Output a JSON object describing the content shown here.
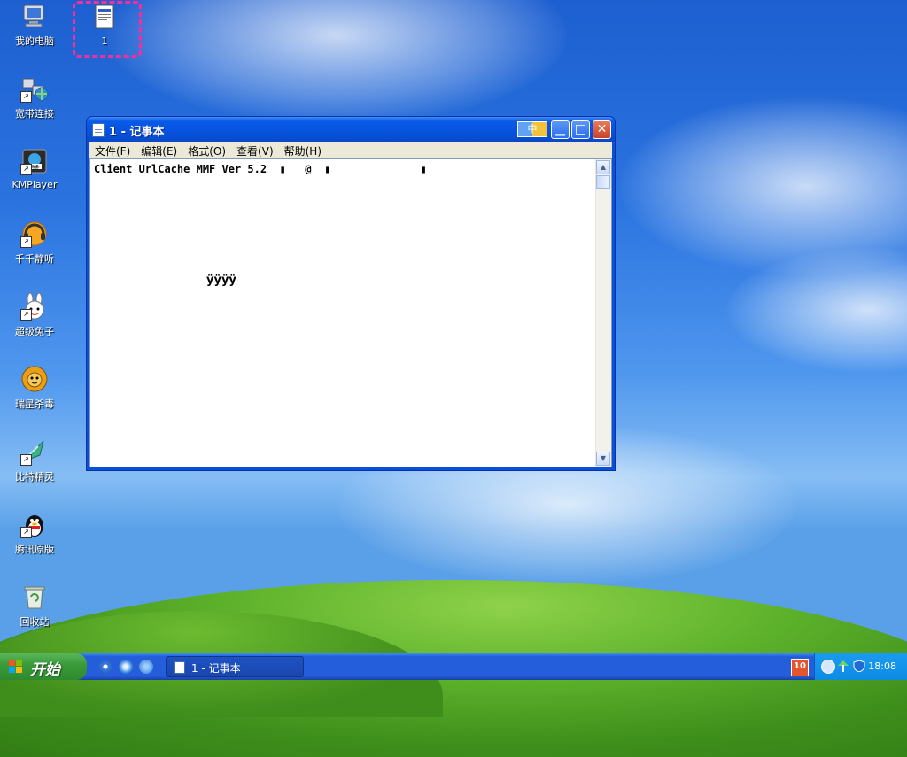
{
  "desktop": {
    "icons": [
      {
        "label": "我的电脑",
        "icon": "my-computer-icon"
      },
      {
        "label": "宽带连接",
        "icon": "network-connection-icon"
      },
      {
        "label": "KMPlayer",
        "icon": "kmplayer-icon"
      },
      {
        "label": "千千静听",
        "icon": "ttplayer-icon"
      },
      {
        "label": "超级兔子",
        "icon": "super-rabbit-icon"
      },
      {
        "label": "瑞星杀毒",
        "icon": "rising-antivirus-icon"
      },
      {
        "label": "比特精灵",
        "icon": "bitspirit-icon"
      },
      {
        "label": "腾讯原版",
        "icon": "qq-icon"
      },
      {
        "label": "回收站",
        "icon": "recycle-bin-icon"
      }
    ],
    "selected_file": {
      "label": "1",
      "icon": "text-file-icon"
    }
  },
  "window": {
    "title": "1 - 记事本",
    "ime_indicator": "中",
    "menu": [
      "文件(F)",
      "编辑(E)",
      "格式(O)",
      "查看(V)",
      "帮助(H)"
    ],
    "content_line": "Client UrlCache MMF Ver 5.2  ▮   @  ▮              ▮",
    "content_blob": "ÿÿÿÿ"
  },
  "taskbar": {
    "start_label": "开始",
    "task_label": "1 - 记事本",
    "ime_label": "10",
    "clock": "18:08"
  },
  "colors": {
    "selection_outline": "#f22f9c",
    "title_bar": "#0553df",
    "start_button": "#3a9b3a"
  }
}
